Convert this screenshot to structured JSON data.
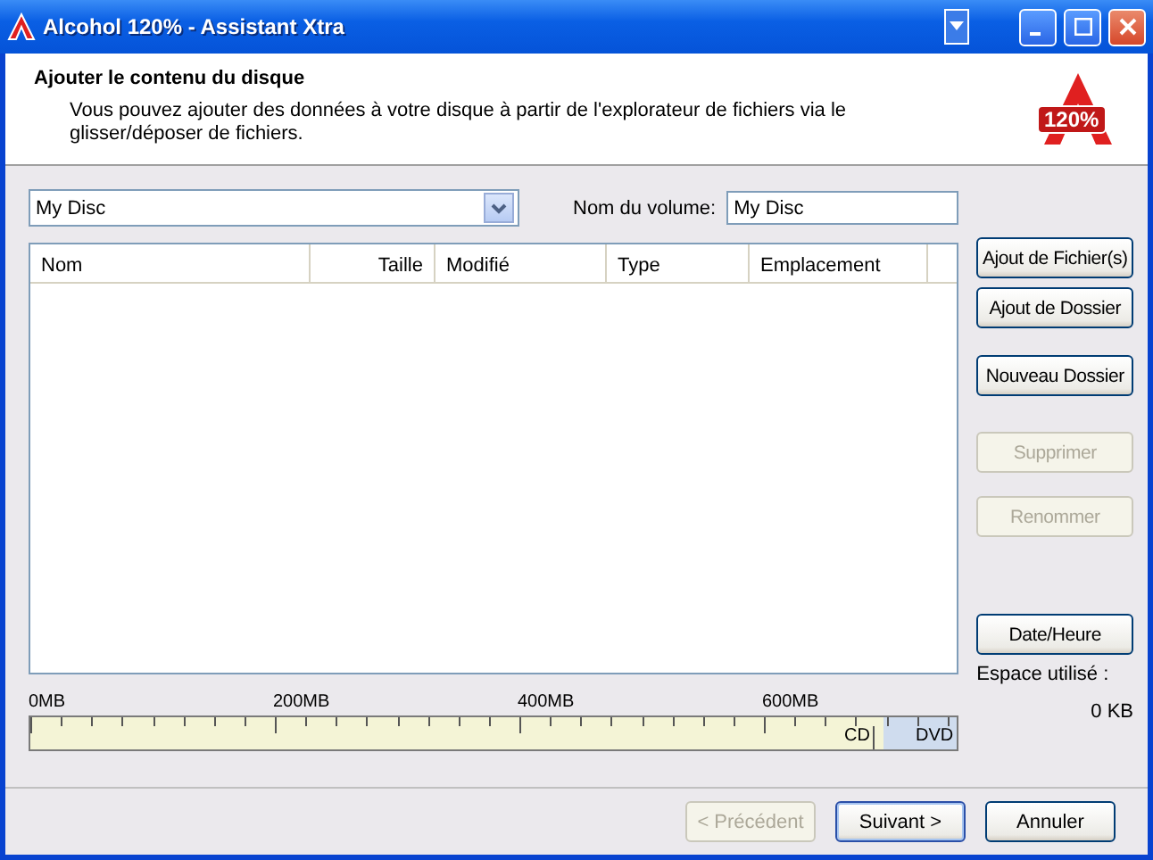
{
  "window": {
    "title": "Alcohol 120% - Assistant Xtra"
  },
  "header": {
    "title": "Ajouter le contenu du disque",
    "description": "Vous pouvez ajouter des données à votre disque à partir de l'explorateur de fichiers via le glisser/déposer de fichiers.",
    "logo_text": "120%"
  },
  "disc_select": {
    "value": "My Disc"
  },
  "volume": {
    "label": "Nom du volume:",
    "value": "My Disc"
  },
  "table": {
    "columns": [
      {
        "label": "Nom"
      },
      {
        "label": "Taille"
      },
      {
        "label": "Modifié"
      },
      {
        "label": "Type"
      },
      {
        "label": "Emplacement"
      }
    ]
  },
  "side_buttons": [
    {
      "label": "Ajout de Fichier(s)",
      "disabled": false
    },
    {
      "label": "Ajout de Dossier",
      "disabled": false
    },
    {
      "label": "Nouveau Dossier",
      "disabled": false
    },
    {
      "label": "Supprimer",
      "disabled": true
    },
    {
      "label": "Renommer",
      "disabled": true
    },
    {
      "label": "Date/Heure",
      "disabled": false
    }
  ],
  "capacity": {
    "scale_labels": [
      "0MB",
      "200MB",
      "400MB",
      "600MB"
    ],
    "cd_label": "CD",
    "dvd_label": "DVD",
    "used_label": "Espace utilisé :",
    "used_value": "0 KB"
  },
  "footer_buttons": [
    {
      "label": "< Précédent",
      "disabled": true
    },
    {
      "label": "Suivant >",
      "disabled": false
    },
    {
      "label": "Annuler",
      "disabled": false
    }
  ]
}
